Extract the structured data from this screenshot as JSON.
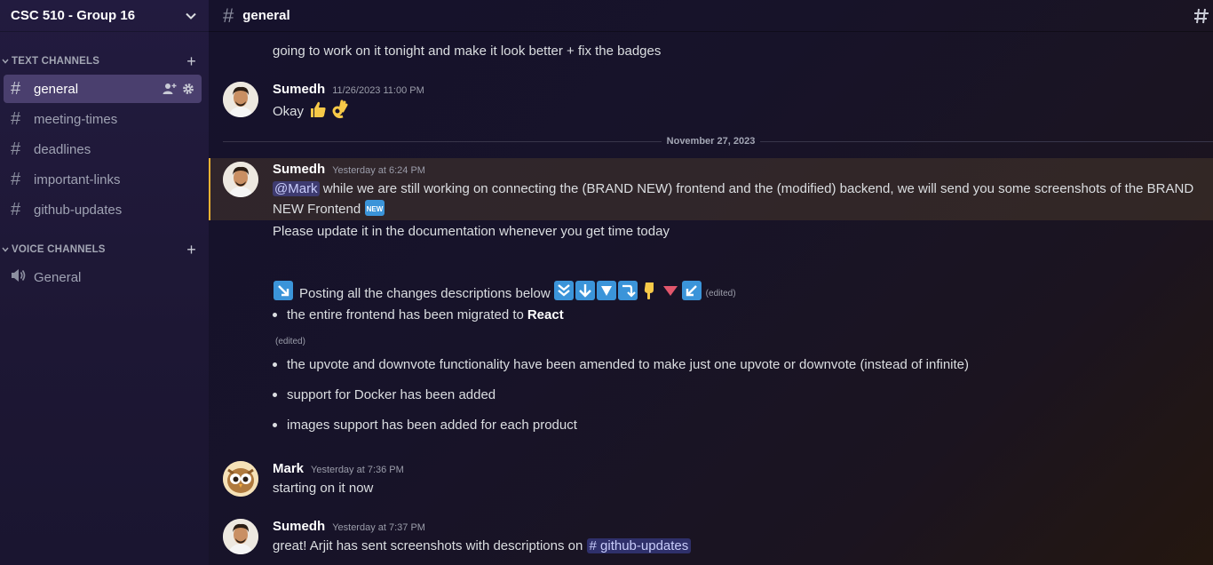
{
  "server": {
    "name": "CSC 510 - Group 16"
  },
  "sidebar": {
    "text_category": "TEXT CHANNELS",
    "voice_category": "VOICE CHANNELS",
    "text_channels": [
      "general",
      "meeting-times",
      "deadlines",
      "important-links",
      "github-updates"
    ],
    "voice_channels": [
      "General"
    ]
  },
  "header": {
    "channel": "general"
  },
  "divider": "November 27, 2023",
  "messages": {
    "m0": {
      "text": "going to work on it tonight and make it look better + fix the badges"
    },
    "m1": {
      "author": "Sumedh",
      "time": "11/26/2023 11:00 PM",
      "text": "Okay"
    },
    "m2": {
      "author": "Sumedh",
      "time": "Yesterday at 6:24 PM",
      "mention": "@Mark",
      "line1": " while we are still working on connecting the (BRAND NEW) frontend and the (modified) backend, we will send you some screenshots of the BRAND",
      "line2": "NEW Frontend",
      "line3": "Please update it in the documentation whenever you get time today",
      "posting": "Posting all the changes descriptions below",
      "edited": "(edited)",
      "bullet1_prefix": "the entire frontend has been migrated to ",
      "bullet1_bold": "React",
      "bullet1_edited": "(edited)",
      "bullet2": "the upvote and downvote functionality have been amended to make just one upvote or downvote (instead of infinite)",
      "bullet3": "support for Docker has been added",
      "bullet4": "images support has been added for each product"
    },
    "m3": {
      "author": "Mark",
      "time": "Yesterday at 7:36 PM",
      "text": "starting on it now"
    },
    "m4": {
      "author": "Sumedh",
      "time": "Yesterday at 7:37 PM",
      "text": "great! Arjit has sent screenshots with descriptions on ",
      "channel_mention": "# github-updates"
    }
  },
  "colors": {
    "accent": "#5865f2",
    "highlight_bar": "#f0b232",
    "active_channel": "#4a3f6e"
  }
}
